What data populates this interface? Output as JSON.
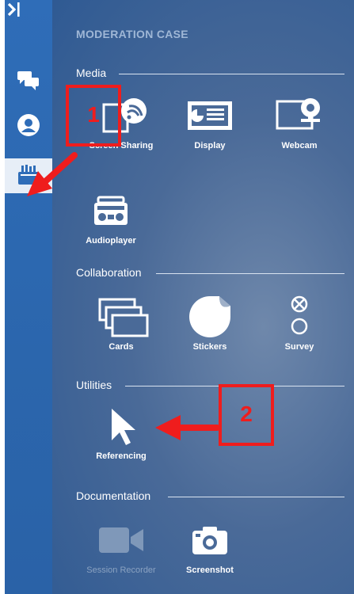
{
  "panel": {
    "title": "MODERATION CASE"
  },
  "sections": {
    "media": "Media",
    "collaboration": "Collaboration",
    "utilities": "Utilities",
    "documentation": "Documentation"
  },
  "tools": {
    "screen_sharing": "Screen Sharing",
    "display": "Display",
    "webcam": "Webcam",
    "audioplayer": "Audioplayer",
    "cards": "Cards",
    "stickers": "Stickers",
    "survey": "Survey",
    "referencing": "Referencing",
    "session_recorder": "Session Recorder",
    "screenshot": "Screenshot"
  },
  "annotations": {
    "marker1": "1",
    "marker2": "2"
  },
  "colors": {
    "accent": "#ef1d1d",
    "rail": "#2f6db8",
    "panel": "#4a6a98"
  }
}
